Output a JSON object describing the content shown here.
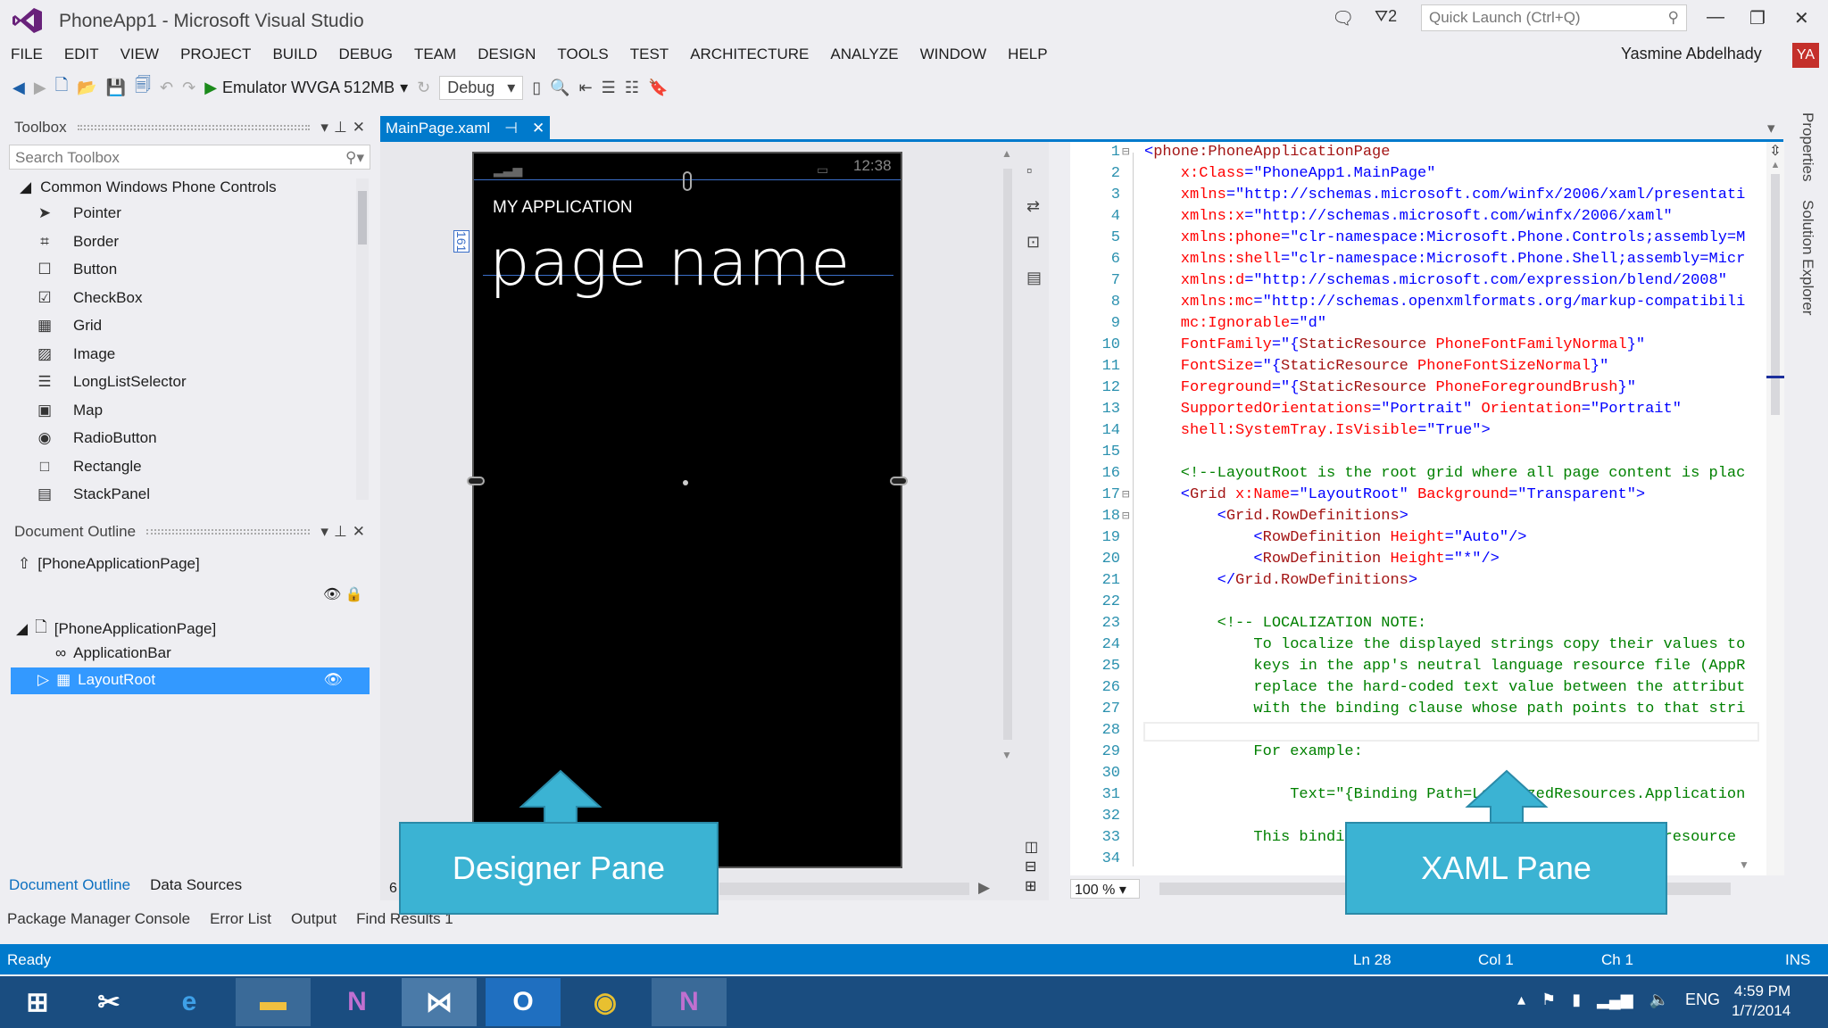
{
  "window": {
    "title": "PhoneApp1 - Microsoft Visual Studio",
    "notifications": "2",
    "quick_launch_placeholder": "Quick Launch (Ctrl+Q)",
    "user": "Yasmine Abdelhady",
    "avatar": "YA"
  },
  "menu": [
    "FILE",
    "EDIT",
    "VIEW",
    "PROJECT",
    "BUILD",
    "DEBUG",
    "TEAM",
    "DESIGN",
    "TOOLS",
    "TEST",
    "ARCHITECTURE",
    "ANALYZE",
    "WINDOW",
    "HELP"
  ],
  "toolbar": {
    "run_target": "Emulator WVGA 512MB",
    "configuration": "Debug"
  },
  "toolbox": {
    "title": "Toolbox",
    "search_placeholder": "Search Toolbox",
    "group": "Common Windows Phone Controls",
    "items": [
      {
        "label": "Pointer",
        "icon": "➤"
      },
      {
        "label": "Border",
        "icon": "⌗"
      },
      {
        "label": "Button",
        "icon": "☐"
      },
      {
        "label": "CheckBox",
        "icon": "☑"
      },
      {
        "label": "Grid",
        "icon": "▦"
      },
      {
        "label": "Image",
        "icon": "▨"
      },
      {
        "label": "LongListSelector",
        "icon": "☰"
      },
      {
        "label": "Map",
        "icon": "▣"
      },
      {
        "label": "RadioButton",
        "icon": "◉"
      },
      {
        "label": "Rectangle",
        "icon": "□"
      },
      {
        "label": "StackPanel",
        "icon": "▤"
      }
    ]
  },
  "outline": {
    "title": "Document Outline",
    "root": "[PhoneApplicationPage]",
    "tree_root": "[PhoneApplicationPage]",
    "app_bar": "ApplicationBar",
    "layout_root": "LayoutRoot"
  },
  "doc_tab": {
    "label": "MainPage.xaml"
  },
  "phone": {
    "clock": "12:38",
    "app_title": "MY APPLICATION",
    "page_name": "page name",
    "margin_label": "161"
  },
  "designer": {
    "zoom": "100 %",
    "zoom_left": "6"
  },
  "xaml_lines": [
    [
      [
        "<",
        "pun"
      ],
      [
        "phone:PhoneApplicationPage",
        "tag"
      ]
    ],
    [
      [
        "    x:Class",
        "attr"
      ],
      [
        "=\"PhoneApp1.MainPage\"",
        "val"
      ]
    ],
    [
      [
        "    xmlns",
        "attr"
      ],
      [
        "=\"http://schemas.microsoft.com/winfx/2006/xaml/presentati",
        "val"
      ]
    ],
    [
      [
        "    xmlns:x",
        "attr"
      ],
      [
        "=\"http://schemas.microsoft.com/winfx/2006/xaml\"",
        "val"
      ]
    ],
    [
      [
        "    xmlns:phone",
        "attr"
      ],
      [
        "=\"clr-namespace:Microsoft.Phone.Controls;assembly=M",
        "val"
      ]
    ],
    [
      [
        "    xmlns:shell",
        "attr"
      ],
      [
        "=\"clr-namespace:Microsoft.Phone.Shell;assembly=Micr",
        "val"
      ]
    ],
    [
      [
        "    xmlns:d",
        "attr"
      ],
      [
        "=\"http://schemas.microsoft.com/expression/blend/2008\"",
        "val"
      ]
    ],
    [
      [
        "    xmlns:mc",
        "attr"
      ],
      [
        "=\"http://schemas.openxmlformats.org/markup-compatibili",
        "val"
      ]
    ],
    [
      [
        "    mc:Ignorable",
        "attr"
      ],
      [
        "=\"d\"",
        "val"
      ]
    ],
    [
      [
        "    FontFamily",
        "attr"
      ],
      [
        "=\"{",
        "val"
      ],
      [
        "StaticResource",
        "tag"
      ],
      [
        " PhoneFontFamilyNormal",
        "attr"
      ],
      [
        "}\"",
        "val"
      ]
    ],
    [
      [
        "    FontSize",
        "attr"
      ],
      [
        "=\"{",
        "val"
      ],
      [
        "StaticResource",
        "tag"
      ],
      [
        " PhoneFontSizeNormal",
        "attr"
      ],
      [
        "}\"",
        "val"
      ]
    ],
    [
      [
        "    Foreground",
        "attr"
      ],
      [
        "=\"{",
        "val"
      ],
      [
        "StaticResource",
        "tag"
      ],
      [
        " PhoneForegroundBrush",
        "attr"
      ],
      [
        "}\"",
        "val"
      ]
    ],
    [
      [
        "    SupportedOrientations",
        "attr"
      ],
      [
        "=\"Portrait\"",
        "val"
      ],
      [
        " Orientation",
        "attr"
      ],
      [
        "=\"Portrait\"",
        "val"
      ]
    ],
    [
      [
        "    shell:SystemTray.IsVisible",
        "attr"
      ],
      [
        "=\"True\">",
        "val"
      ]
    ],
    [
      [
        "",
        ""
      ]
    ],
    [
      [
        "    <!--LayoutRoot is the root grid where all page content is plac",
        "cmt"
      ]
    ],
    [
      [
        "    <",
        "pun"
      ],
      [
        "Grid",
        "tag"
      ],
      [
        " x:Name",
        "attr"
      ],
      [
        "=\"LayoutRoot\"",
        "val"
      ],
      [
        " Background",
        "attr"
      ],
      [
        "=\"Transparent\">",
        "val"
      ]
    ],
    [
      [
        "        <",
        "pun"
      ],
      [
        "Grid.RowDefinitions",
        "tag"
      ],
      [
        ">",
        "pun"
      ]
    ],
    [
      [
        "            <",
        "pun"
      ],
      [
        "RowDefinition",
        "tag"
      ],
      [
        " Height",
        "attr"
      ],
      [
        "=\"Auto\"/>",
        "val"
      ]
    ],
    [
      [
        "            <",
        "pun"
      ],
      [
        "RowDefinition",
        "tag"
      ],
      [
        " Height",
        "attr"
      ],
      [
        "=\"*\"/>",
        "val"
      ]
    ],
    [
      [
        "        </",
        "pun"
      ],
      [
        "Grid.RowDefinitions",
        "tag"
      ],
      [
        ">",
        "pun"
      ]
    ],
    [
      [
        "",
        ""
      ]
    ],
    [
      [
        "        <!-- LOCALIZATION NOTE:",
        "cmt"
      ]
    ],
    [
      [
        "            To localize the displayed strings copy their values to",
        "cmt"
      ]
    ],
    [
      [
        "            keys in the app's neutral language resource file (AppR",
        "cmt"
      ]
    ],
    [
      [
        "            replace the hard-coded text value between the attribut",
        "cmt"
      ]
    ],
    [
      [
        "            with the binding clause whose path points to that stri",
        "cmt"
      ]
    ],
    [
      [
        "",
        ""
      ]
    ],
    [
      [
        "            For example:",
        "cmt"
      ]
    ],
    [
      [
        "",
        ""
      ]
    ],
    [
      [
        "                Text=\"{Binding Path=LocalizedResources.Application",
        "cmt"
      ]
    ],
    [
      [
        "",
        ""
      ]
    ],
    [
      [
        "            This binding points to the template's string resource",
        "cmt"
      ]
    ],
    [
      [
        "",
        ""
      ]
    ]
  ],
  "callouts": {
    "designer": "Designer Pane",
    "xaml": "XAML Pane"
  },
  "bottom_tabs": [
    "Document Outline",
    "Data Sources"
  ],
  "tool_tabs": [
    "Package Manager Console",
    "Error List",
    "Output",
    "Find Results 1"
  ],
  "right_sidebar": [
    "Properties",
    "Solution Explorer"
  ],
  "status": {
    "text": "Ready",
    "ln": "Ln 28",
    "col": "Col 1",
    "ch": "Ch 1",
    "mode": "INS"
  },
  "taskbar": {
    "lang": "ENG",
    "time": "4:59 PM",
    "date": "1/7/2014"
  },
  "colors": {
    "accent": "#007acc",
    "callout": "#3bb3d3",
    "selection": "#3399ff",
    "vs_purple": "#68217a"
  }
}
